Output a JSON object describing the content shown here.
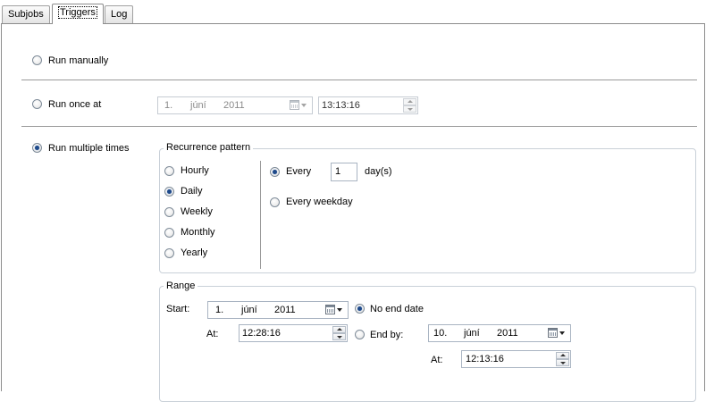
{
  "tabs": [
    {
      "label": "Subjobs"
    },
    {
      "label": "Triggers"
    },
    {
      "label": "Log"
    }
  ],
  "active_tab": "Triggers",
  "trigger_mode": {
    "run_manually": "Run manually",
    "run_once": "Run once at",
    "run_multiple": "Run multiple times",
    "selected": "run_multiple"
  },
  "run_once": {
    "date_day": "1.",
    "date_month": "júní",
    "date_year": "2011",
    "time": "13:13:16"
  },
  "recurrence": {
    "title": "Recurrence pattern",
    "options": [
      "Hourly",
      "Daily",
      "Weekly",
      "Monthly",
      "Yearly"
    ],
    "selected": "Daily",
    "every_label": "Every",
    "every_value": "1",
    "unit_label": "day(s)",
    "every_weekday_label": "Every weekday",
    "daily_selected": "every"
  },
  "range": {
    "title": "Range",
    "start_label": "Start:",
    "start_day": "1.",
    "start_month": "júní",
    "start_year": "2011",
    "at_label": "At:",
    "start_time": "12:28:16",
    "no_end_label": "No end date",
    "end_by_label": "End by:",
    "end_day": "10.",
    "end_month": "júní",
    "end_year": "2011",
    "end_at_label": "At:",
    "end_time": "12:13:16",
    "selected": "no_end"
  }
}
